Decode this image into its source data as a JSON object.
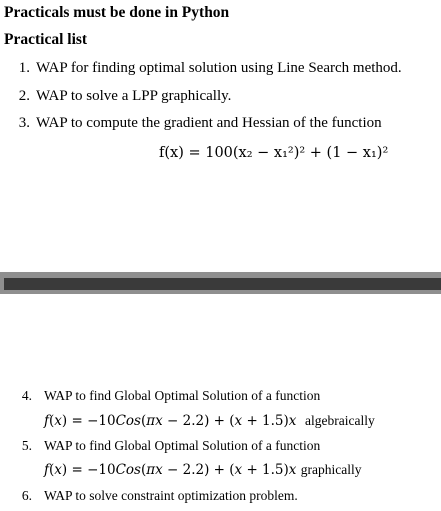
{
  "header": {
    "title": "Practicals must be done in Python",
    "subtitle": "Practical list"
  },
  "list_top": [
    {
      "num": "1.",
      "text": "WAP for finding optimal solution using Line Search method."
    },
    {
      "num": "2.",
      "text": "WAP to solve a LPP graphically."
    },
    {
      "num": "3.",
      "text": "WAP to compute the gradient and Hessian of the function"
    }
  ],
  "equations": {
    "rosenbrock": "f(x) = 100(x₂ − x₁²)² + (1 − x₁)²",
    "global_alg_suffix": "algebraically",
    "global_graph_suffix": "graphically"
  },
  "list_bottom": [
    {
      "num": "4.",
      "text": "WAP to find Global Optimal Solution of a function"
    },
    {
      "num": "5.",
      "text": "WAP to find Global Optimal Solution of a function"
    },
    {
      "num": "6.",
      "text": "WAP to solve constraint optimization problem."
    }
  ]
}
